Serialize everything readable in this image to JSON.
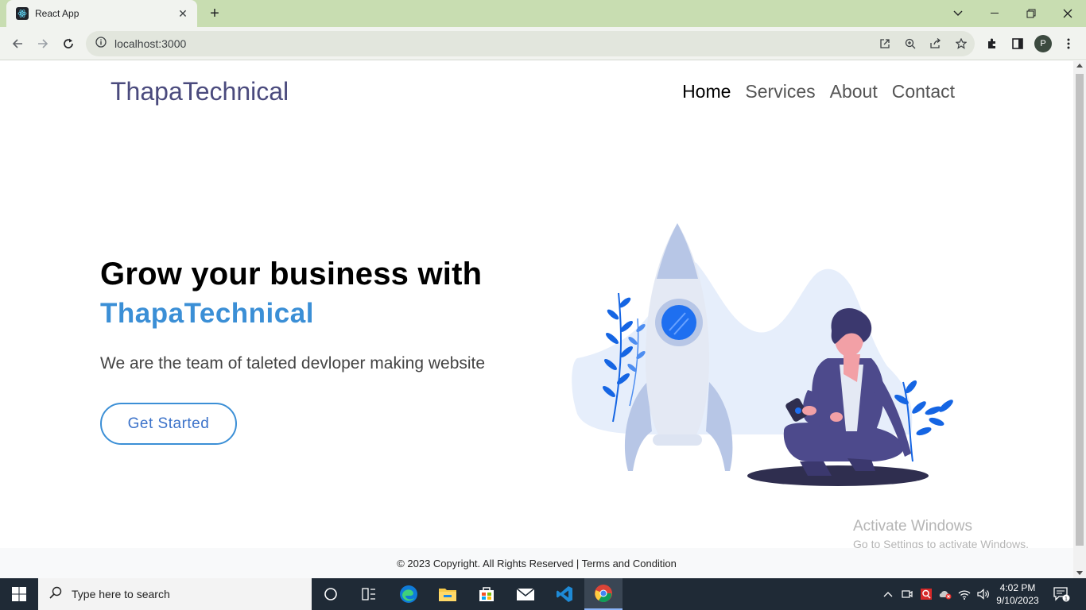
{
  "browser": {
    "tab_title": "React App",
    "url": "localhost:3000",
    "profile_initial": "P"
  },
  "site": {
    "brand": "ThapaTechnical",
    "nav": [
      "Home",
      "Services",
      "About",
      "Contact"
    ],
    "hero": {
      "title": "Grow your business with",
      "brand": "ThapaTechnical",
      "subtitle": "We are the team of taleted devloper making website",
      "cta": "Get Started"
    },
    "footer": "© 2023 Copyright. All Rights Reserved | Terms and Condition"
  },
  "watermark": {
    "line1": "Activate Windows",
    "line2": "Go to Settings to activate Windows."
  },
  "taskbar": {
    "search_placeholder": "Type here to search",
    "time": "4:02 PM",
    "date": "9/10/2023",
    "notification_count": "1"
  },
  "colors": {
    "accent": "#3b8fd6",
    "brand": "#4a4a7d",
    "tabstrip": "#c8ddb1"
  }
}
